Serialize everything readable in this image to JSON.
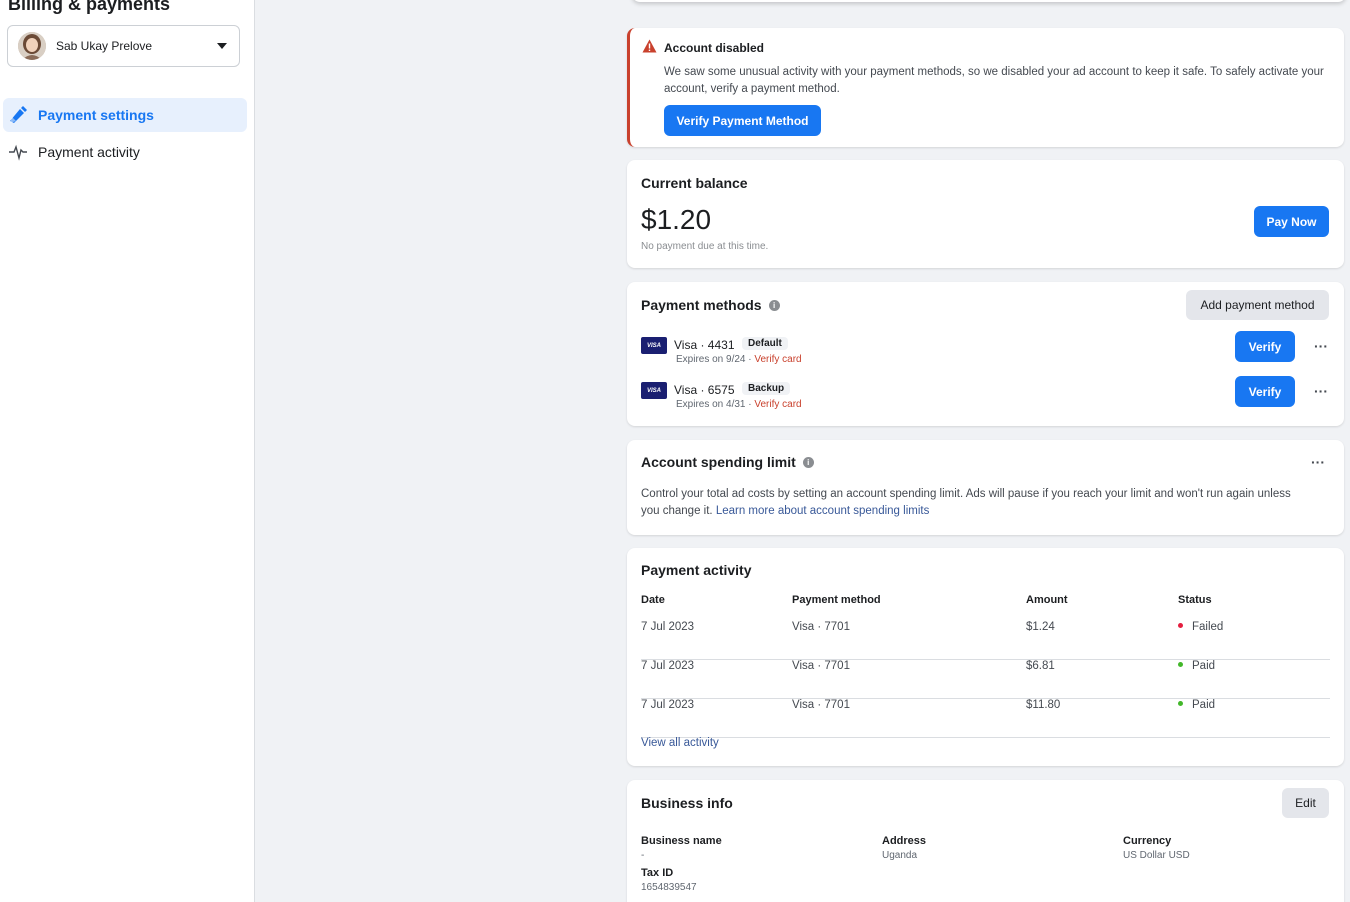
{
  "sidebar": {
    "title": "Billing & payments",
    "account_name": "Sab Ukay Prelove",
    "nav": [
      {
        "label": "Payment settings",
        "icon": "pencil-icon"
      },
      {
        "label": "Payment activity",
        "icon": "activity-pulse-icon"
      }
    ]
  },
  "alert": {
    "title": "Account disabled",
    "body": "We saw some unusual activity with your payment methods, so we disabled your ad account to keep it safe. To safely activate your account, verify a payment method.",
    "button": "Verify Payment Method"
  },
  "balance": {
    "title": "Current balance",
    "amount": "$1.20",
    "note": "No payment due at this time.",
    "button": "Pay Now"
  },
  "payment_methods": {
    "title": "Payment methods",
    "add_button": "Add payment method",
    "items": [
      {
        "brand": "VISA",
        "name": "Visa · 4431",
        "badge": "Default",
        "expires": "Expires on 9/24 · ",
        "verify_link": "Verify card",
        "button": "Verify"
      },
      {
        "brand": "VISA",
        "name": "Visa · 6575",
        "badge": "Backup",
        "expires": "Expires on 4/31 · ",
        "verify_link": "Verify card",
        "button": "Verify"
      }
    ]
  },
  "spending_limit": {
    "title": "Account spending limit",
    "body": "Control your total ad costs by setting an account spending limit. Ads will pause if you reach your limit and won't run again unless you change it. ",
    "link": "Learn more about account spending limits"
  },
  "activity": {
    "title": "Payment activity",
    "columns": [
      "Date",
      "Payment method",
      "Amount",
      "Status"
    ],
    "rows": [
      {
        "date": "7 Jul 2023",
        "method": "Visa · 7701",
        "amount": "$1.24",
        "status": "Failed",
        "status_color": "#e41e3f"
      },
      {
        "date": "7 Jul 2023",
        "method": "Visa · 7701",
        "amount": "$6.81",
        "status": "Paid",
        "status_color": "#42b72a"
      },
      {
        "date": "7 Jul 2023",
        "method": "Visa · 7701",
        "amount": "$11.80",
        "status": "Paid",
        "status_color": "#42b72a"
      }
    ],
    "view_all": "View all activity"
  },
  "business": {
    "title": "Business info",
    "edit_button": "Edit",
    "name_label": "Business name",
    "name_value": "-",
    "address_label": "Address",
    "address_value": "Uganda",
    "currency_label": "Currency",
    "currency_value": "US Dollar USD",
    "tax_label": "Tax ID",
    "tax_value": "1654839547"
  },
  "colors": {
    "accent": "#1877f2",
    "danger": "#c9412d",
    "link": "#385898"
  }
}
